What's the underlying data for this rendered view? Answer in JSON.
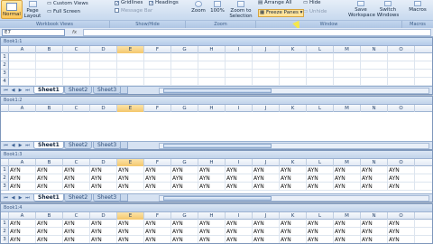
{
  "ribbon": {
    "normal_label": "Normal",
    "page_layout_label": "Page\nLayout",
    "custom_views_label": "Custom Views",
    "full_screen_label": "Full Screen",
    "gridlines_label": "Gridlines",
    "message_bar_label": "Message Bar",
    "headings_label": "Headings",
    "zoom_label": "Zoom",
    "zoom100_label": "100%",
    "zoom_selection_label": "Zoom to\nSelection",
    "arrange_all_label": "Arrange All",
    "freeze_panes_label": "Freeze Panes",
    "hide_label": "Hide",
    "unhide_label": "Unhide",
    "save_workspace_label": "Save\nWorkspace",
    "switch_windows_label": "Switch\nWindows",
    "macros_label": "Macros",
    "groups": [
      "Workbook Views",
      "Show/Hide",
      "Zoom",
      "Window",
      "Macros"
    ]
  },
  "formula": {
    "namebox": "E7",
    "fx": "fx",
    "value": ""
  },
  "columns": [
    "A",
    "B",
    "C",
    "D",
    "E",
    "F",
    "G",
    "H",
    "I",
    "J",
    "K",
    "L",
    "M",
    "N",
    "O"
  ],
  "selected_column": "E",
  "cell_value": "AYN",
  "windows": [
    {
      "title": "Book1:1",
      "rows": [
        "1",
        "2",
        "3",
        "4"
      ],
      "filled": false
    },
    {
      "title": "Book1:2",
      "rows": [],
      "filled": false
    },
    {
      "title": "Book1:3",
      "rows": [
        "1",
        "2",
        "3"
      ],
      "filled": true
    },
    {
      "title": "Book1:4",
      "rows": [
        "1",
        "2",
        "3"
      ],
      "filled": true
    }
  ],
  "sheet_tabs": [
    "Sheet1",
    "Sheet2",
    "Sheet3"
  ]
}
